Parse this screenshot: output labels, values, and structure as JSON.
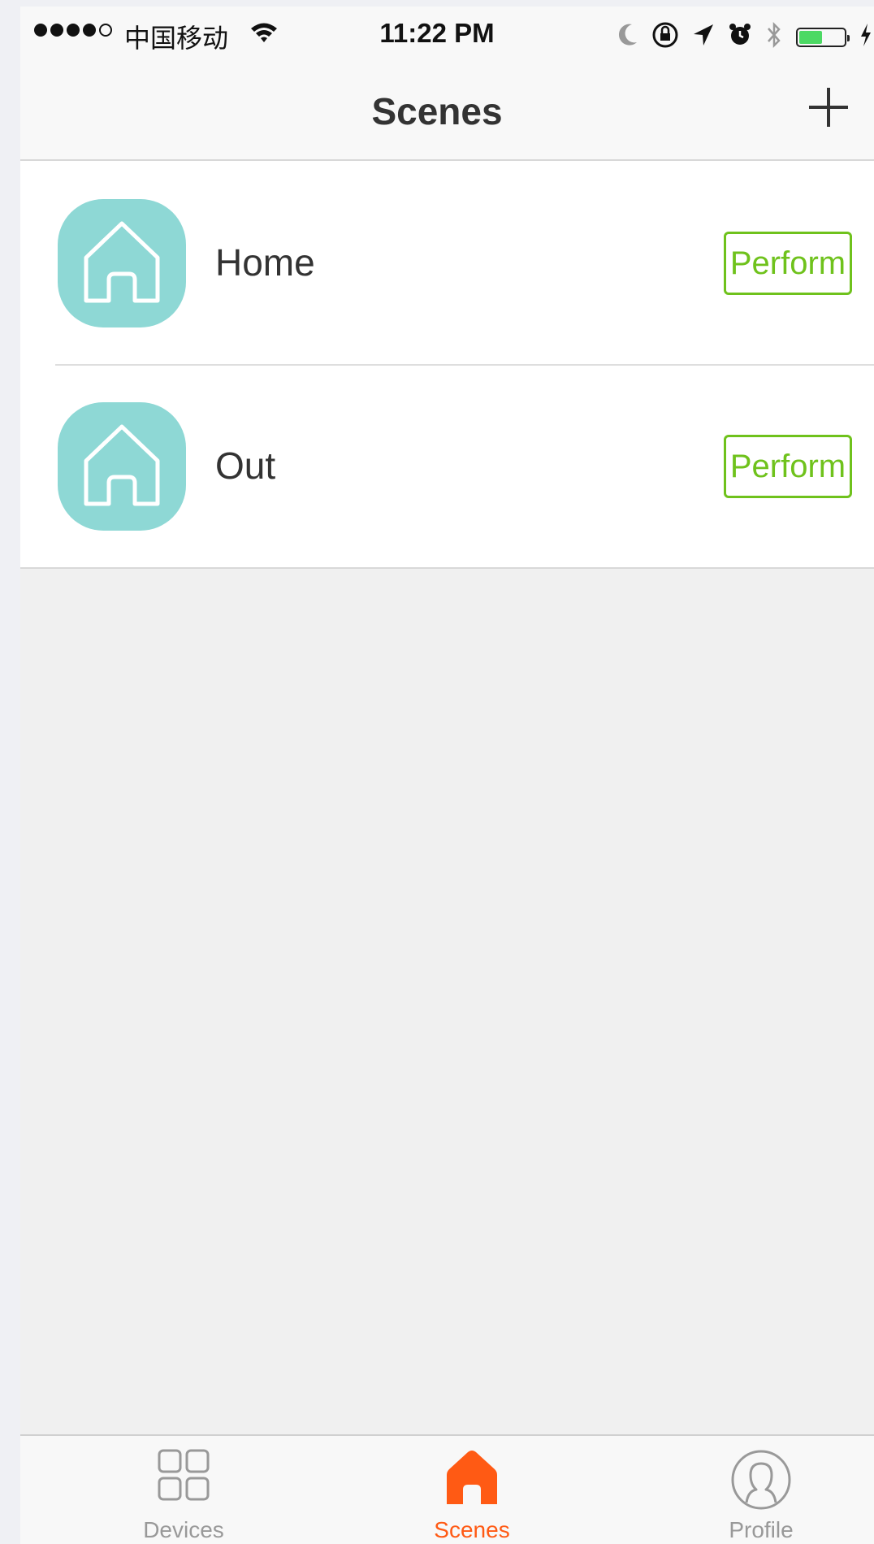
{
  "status_bar": {
    "carrier": "中国移动",
    "time": "11:22 PM",
    "icons": [
      "signal-dots",
      "wifi-icon",
      "moon-icon",
      "rotation-lock-icon",
      "location-arrow-icon",
      "alarm-icon",
      "bluetooth-icon",
      "battery-icon",
      "charging-bolt-icon"
    ],
    "battery_color": "#4cd964"
  },
  "nav": {
    "title": "Scenes",
    "add_icon": "plus-icon"
  },
  "scenes": [
    {
      "name": "Home",
      "action_label": "Perform",
      "icon": "house-icon"
    },
    {
      "name": "Out",
      "action_label": "Perform",
      "icon": "house-icon"
    }
  ],
  "tabs": [
    {
      "label": "Devices",
      "icon": "grid-icon",
      "active": false
    },
    {
      "label": "Scenes",
      "icon": "house-icon",
      "active": true
    },
    {
      "label": "Profile",
      "icon": "person-icon",
      "active": false
    }
  ],
  "colors": {
    "accent": "#ff5a14",
    "perform_green": "#6fc21c",
    "scene_icon_bg": "#8ed8d5"
  }
}
